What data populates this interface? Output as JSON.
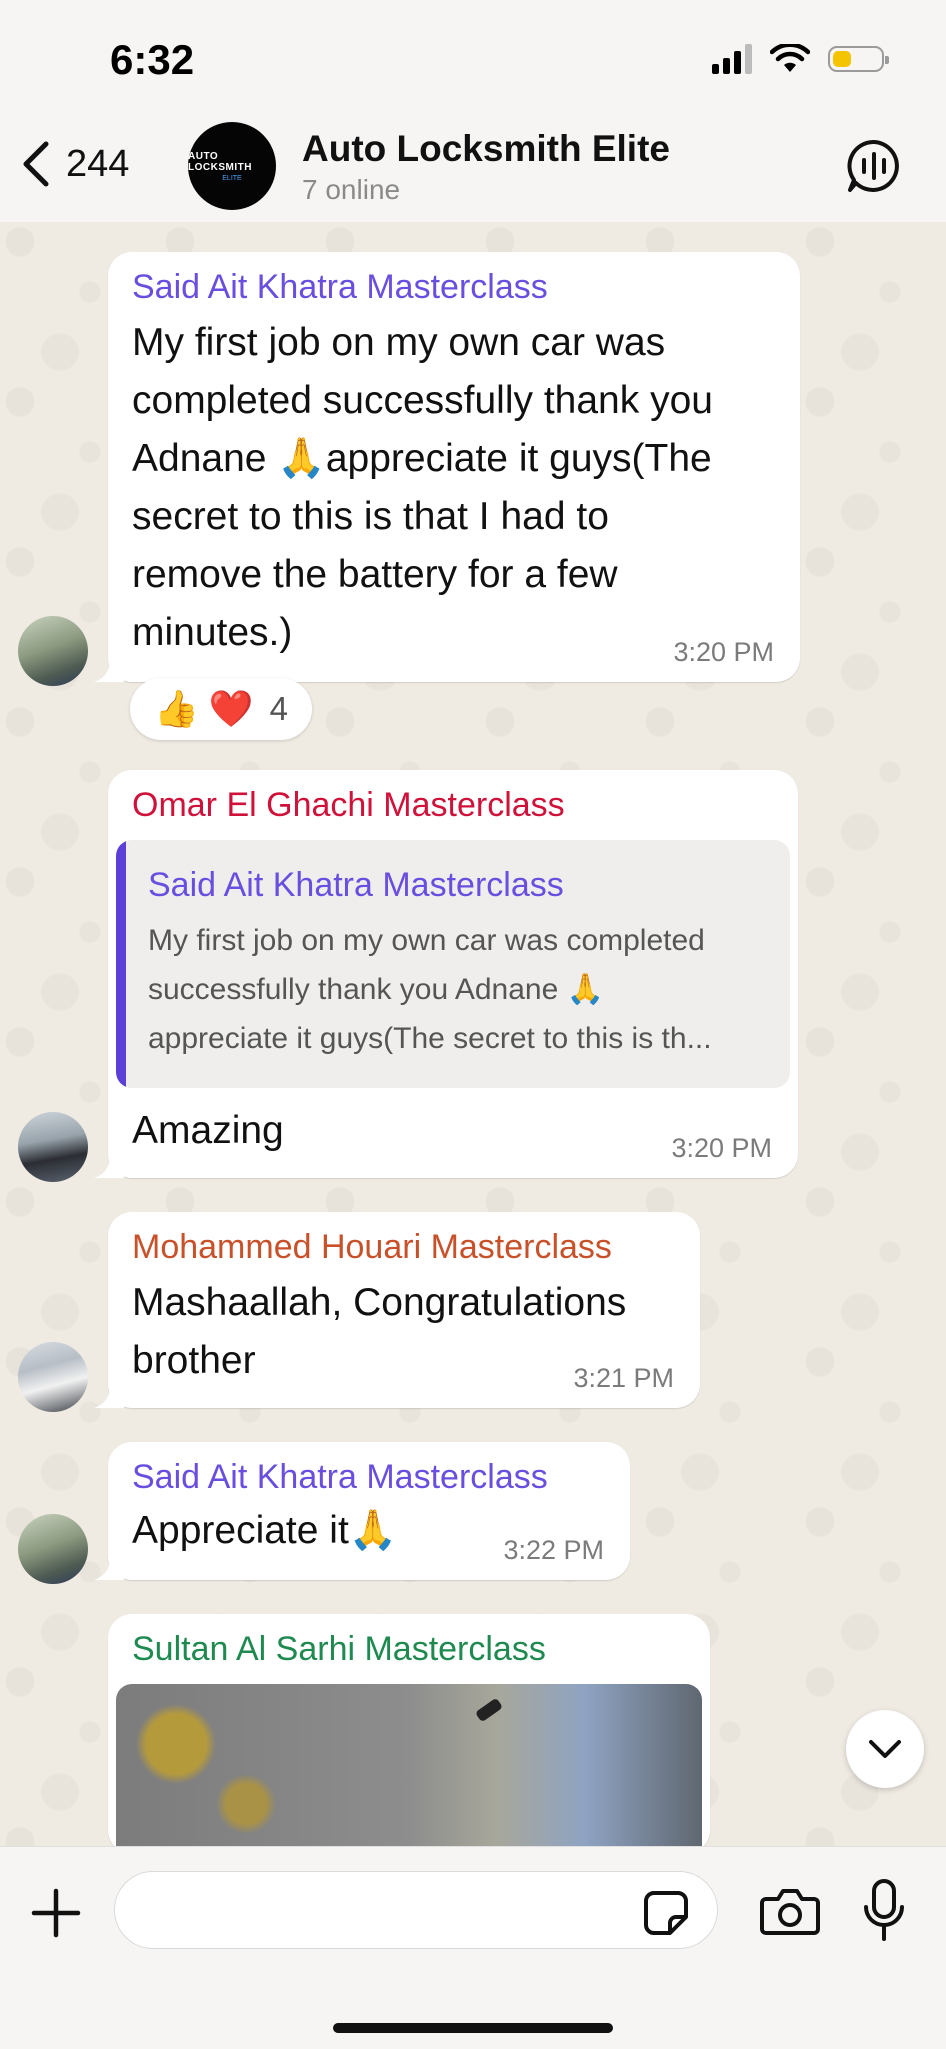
{
  "status_bar": {
    "time": "6:32",
    "battery_level": 0.4
  },
  "header": {
    "back_count": "244",
    "group_name": "Auto Locksmith Elite",
    "subtitle": "7 online",
    "logo_text": "AUTO LOCKSMITH",
    "logo_sub": "ELITE"
  },
  "messages": [
    {
      "sender": "Said Ait Khatra Masterclass",
      "sender_color": "#6a4ee0",
      "text": "My first job on my own car was\ncompleted successfully  thank you\nAdnane 🙏appreciate it guys(The\nsecret to this is that I had to\nremove the battery for a few\nminutes.)",
      "time": "3:20 PM",
      "reactions": {
        "emojis": "👍 ❤️",
        "count": "4"
      }
    },
    {
      "sender": "Omar El Ghachi Masterclass",
      "sender_color": "#d0123a",
      "quote": {
        "sender": "Said Ait Khatra Masterclass",
        "text": "My first job on my own car was completed\nsuccessfully  thank you Adnane 🙏\nappreciate it guys(The secret to this is th..."
      },
      "text": "Amazing",
      "time": "3:20 PM"
    },
    {
      "sender": "Mohammed Houari Masterclass",
      "sender_color": "#c8512a",
      "text": "Mashaallah, Congratulations\nbrother",
      "time": "3:21 PM"
    },
    {
      "sender": "Said Ait Khatra Masterclass",
      "sender_color": "#6a4ee0",
      "text": "Appreciate it🙏",
      "time": "3:22 PM"
    },
    {
      "sender": "Sultan Al Sarhi Masterclass",
      "sender_color": "#1f8a50"
    }
  ],
  "input": {
    "placeholder": ""
  }
}
